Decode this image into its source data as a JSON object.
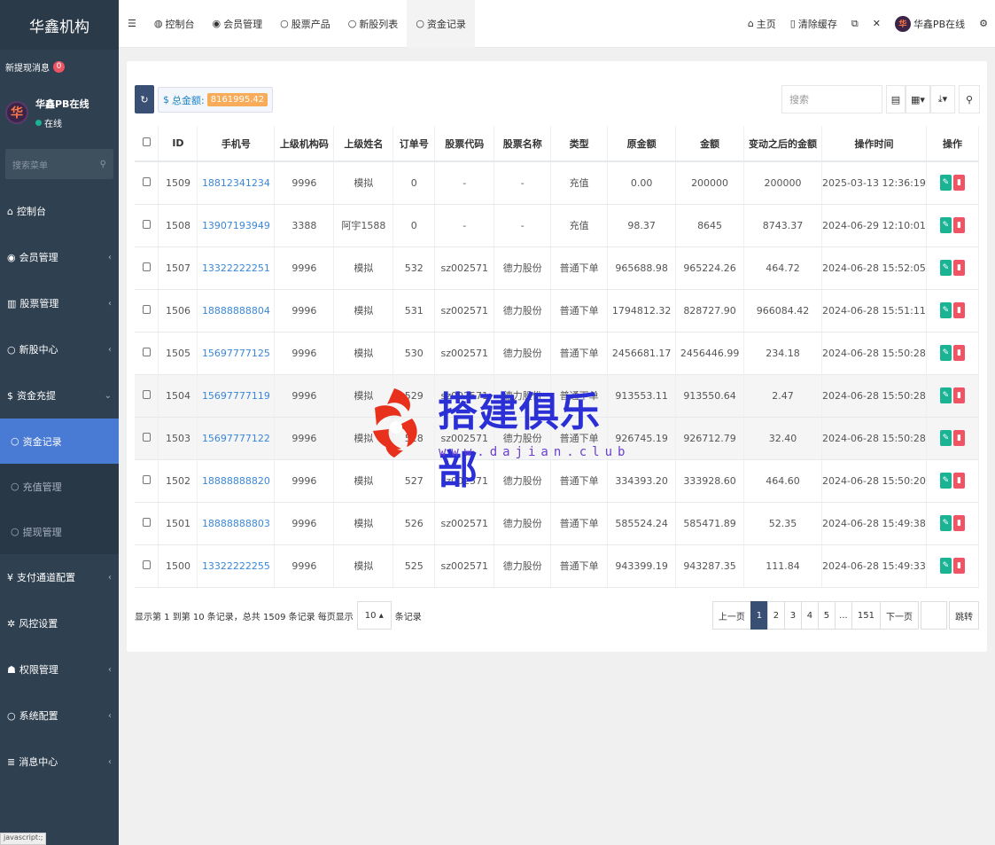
{
  "sidebar": {
    "brand": "华鑫机构",
    "notify_label": "新提现消息",
    "notify_count": "0",
    "user_name": "华鑫PB在线",
    "user_status": "在线",
    "search_placeholder": "搜索菜单",
    "menu": {
      "dashboard": "控制台",
      "members": "会员管理",
      "stocks": "股票管理",
      "ipo": "新股中心",
      "funds": "资金充提",
      "fund_records": "资金记录",
      "recharge": "充值管理",
      "withdraw": "提现管理",
      "payment": "支付通道配置",
      "risk": "风控设置",
      "permission": "权限管理",
      "system": "系统配置",
      "message": "消息中心"
    },
    "status_text": "javascript:;"
  },
  "topbar": {
    "tabs": [
      "控制台",
      "会员管理",
      "股票产品",
      "新股列表",
      "资金记录"
    ],
    "home": "主页",
    "clear_cache": "清除缓存",
    "user": "华鑫PB在线"
  },
  "toolbar": {
    "total_label": "总金额:",
    "total_amount": "8161995.42",
    "search_placeholder": "搜索"
  },
  "table": {
    "headers": [
      "ID",
      "手机号",
      "上级机构码",
      "上级姓名",
      "订单号",
      "股票代码",
      "股票名称",
      "类型",
      "原金额",
      "金额",
      "变动之后的金额",
      "操作时间",
      "操作"
    ],
    "rows": [
      [
        "1509",
        "18812341234",
        "9996",
        "模拟",
        "0",
        "-",
        "-",
        "充值",
        "0.00",
        "200000",
        "200000",
        "2025-03-13 12:36:19"
      ],
      [
        "1508",
        "13907193949",
        "3388",
        "阿宇1588",
        "0",
        "-",
        "-",
        "充值",
        "98.37",
        "8645",
        "8743.37",
        "2024-06-29 12:10:01"
      ],
      [
        "1507",
        "13322222251",
        "9996",
        "模拟",
        "532",
        "sz002571",
        "德力股份",
        "普通下单",
        "965688.98",
        "965224.26",
        "464.72",
        "2024-06-28 15:52:05"
      ],
      [
        "1506",
        "18888888804",
        "9996",
        "模拟",
        "531",
        "sz002571",
        "德力股份",
        "普通下单",
        "1794812.32",
        "828727.90",
        "966084.42",
        "2024-06-28 15:51:11"
      ],
      [
        "1505",
        "15697777125",
        "9996",
        "模拟",
        "530",
        "sz002571",
        "德力股份",
        "普通下单",
        "2456681.17",
        "2456446.99",
        "234.18",
        "2024-06-28 15:50:28"
      ],
      [
        "1504",
        "15697777119",
        "9996",
        "模拟",
        "529",
        "sz002571",
        "德力股份",
        "普通下单",
        "913553.11",
        "913550.64",
        "2.47",
        "2024-06-28 15:50:28"
      ],
      [
        "1503",
        "15697777122",
        "9996",
        "模拟",
        "528",
        "sz002571",
        "德力股份",
        "普通下单",
        "926745.19",
        "926712.79",
        "32.40",
        "2024-06-28 15:50:28"
      ],
      [
        "1502",
        "18888888820",
        "9996",
        "模拟",
        "527",
        "sz002571",
        "德力股份",
        "普通下单",
        "334393.20",
        "333928.60",
        "464.60",
        "2024-06-28 15:50:20"
      ],
      [
        "1501",
        "18888888803",
        "9996",
        "模拟",
        "526",
        "sz002571",
        "德力股份",
        "普通下单",
        "585524.24",
        "585471.89",
        "52.35",
        "2024-06-28 15:49:38"
      ],
      [
        "1500",
        "13322222255",
        "9996",
        "模拟",
        "525",
        "sz002571",
        "德力股份",
        "普通下单",
        "943399.19",
        "943287.35",
        "111.84",
        "2024-06-28 15:49:33"
      ]
    ]
  },
  "footer": {
    "info": "显示第 1 到第 10 条记录，总共 1509 条记录 每页显示",
    "page_size": "10",
    "info_suffix": "条记录"
  },
  "pager": {
    "prev": "上一页",
    "pages": [
      "1",
      "2",
      "3",
      "4",
      "5",
      "...",
      "151"
    ],
    "next": "下一页",
    "jump": "跳转"
  },
  "watermark": {
    "text": "搭建俱乐部",
    "url": "www.dajian.club"
  },
  "colors": {
    "sidebar_bg": "#2f4050",
    "active_menu": "#4a7bd4",
    "edit_btn": "#1ab394",
    "delete_btn": "#ed5565",
    "total_badge": "#f8ac59"
  }
}
